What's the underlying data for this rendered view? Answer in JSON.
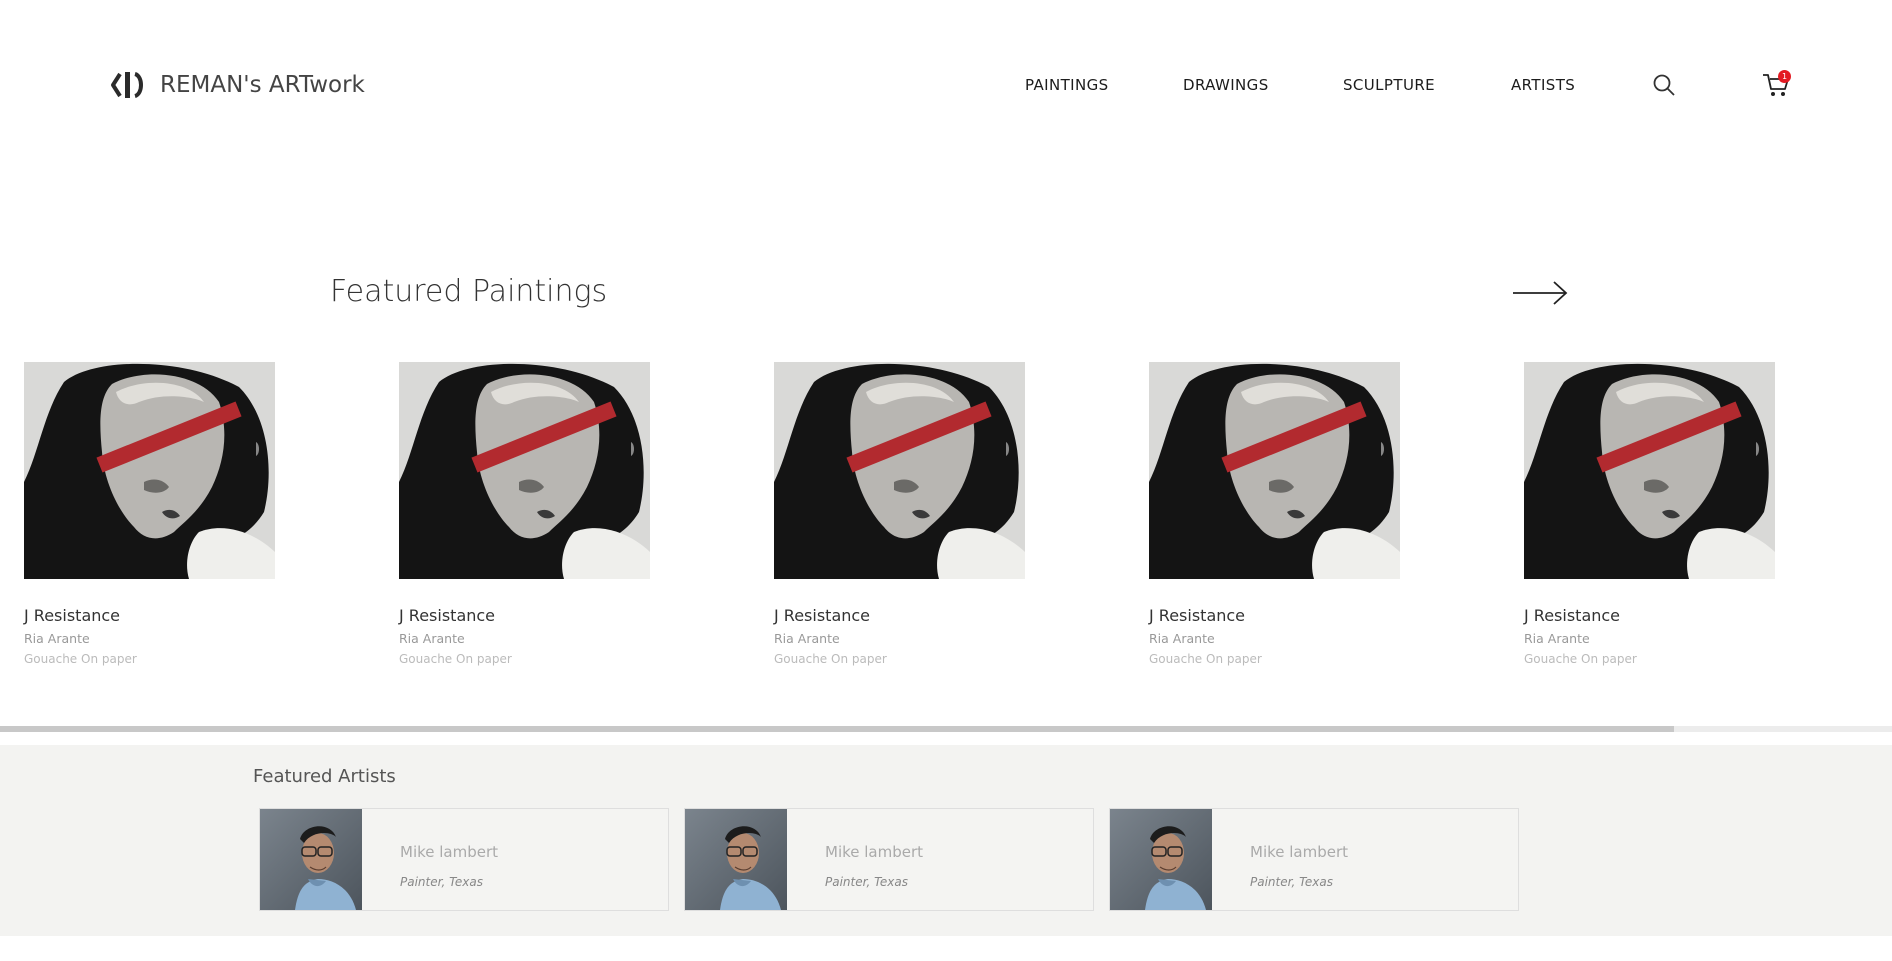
{
  "header": {
    "brand": "REMAN's ARTwork",
    "nav": [
      "PAINTINGS",
      "DRAWINGS",
      "SCULPTURE",
      "ARTISTS"
    ],
    "search_icon": "search-icon",
    "cart_icon": "cart-icon",
    "cart_count": "1"
  },
  "featured_paintings": {
    "title": "Featured Paintings",
    "next_icon": "arrow-right-icon",
    "items": [
      {
        "title": "J Resistance",
        "artist": "Ria Arante",
        "medium": "Gouache On paper"
      },
      {
        "title": "J Resistance",
        "artist": "Ria Arante",
        "medium": "Gouache On paper"
      },
      {
        "title": "J Resistance",
        "artist": "Ria Arante",
        "medium": "Gouache On paper"
      },
      {
        "title": "J Resistance",
        "artist": "Ria Arante",
        "medium": "Gouache On paper"
      },
      {
        "title": "J Resistance",
        "artist": "Ria Arante",
        "medium": "Gouache On paper"
      }
    ],
    "scroll_progress": 0.885
  },
  "featured_artists": {
    "title": "Featured Artists",
    "items": [
      {
        "name": "Mike lambert",
        "role": "Painter, Texas"
      },
      {
        "name": "Mike lambert",
        "role": "Painter, Texas"
      },
      {
        "name": "Mike lambert",
        "role": "Painter, Texas"
      }
    ]
  },
  "colors": {
    "accent_red": "#b22a2f",
    "badge_red": "#e31b23",
    "band_bg": "#f3f3f1"
  }
}
